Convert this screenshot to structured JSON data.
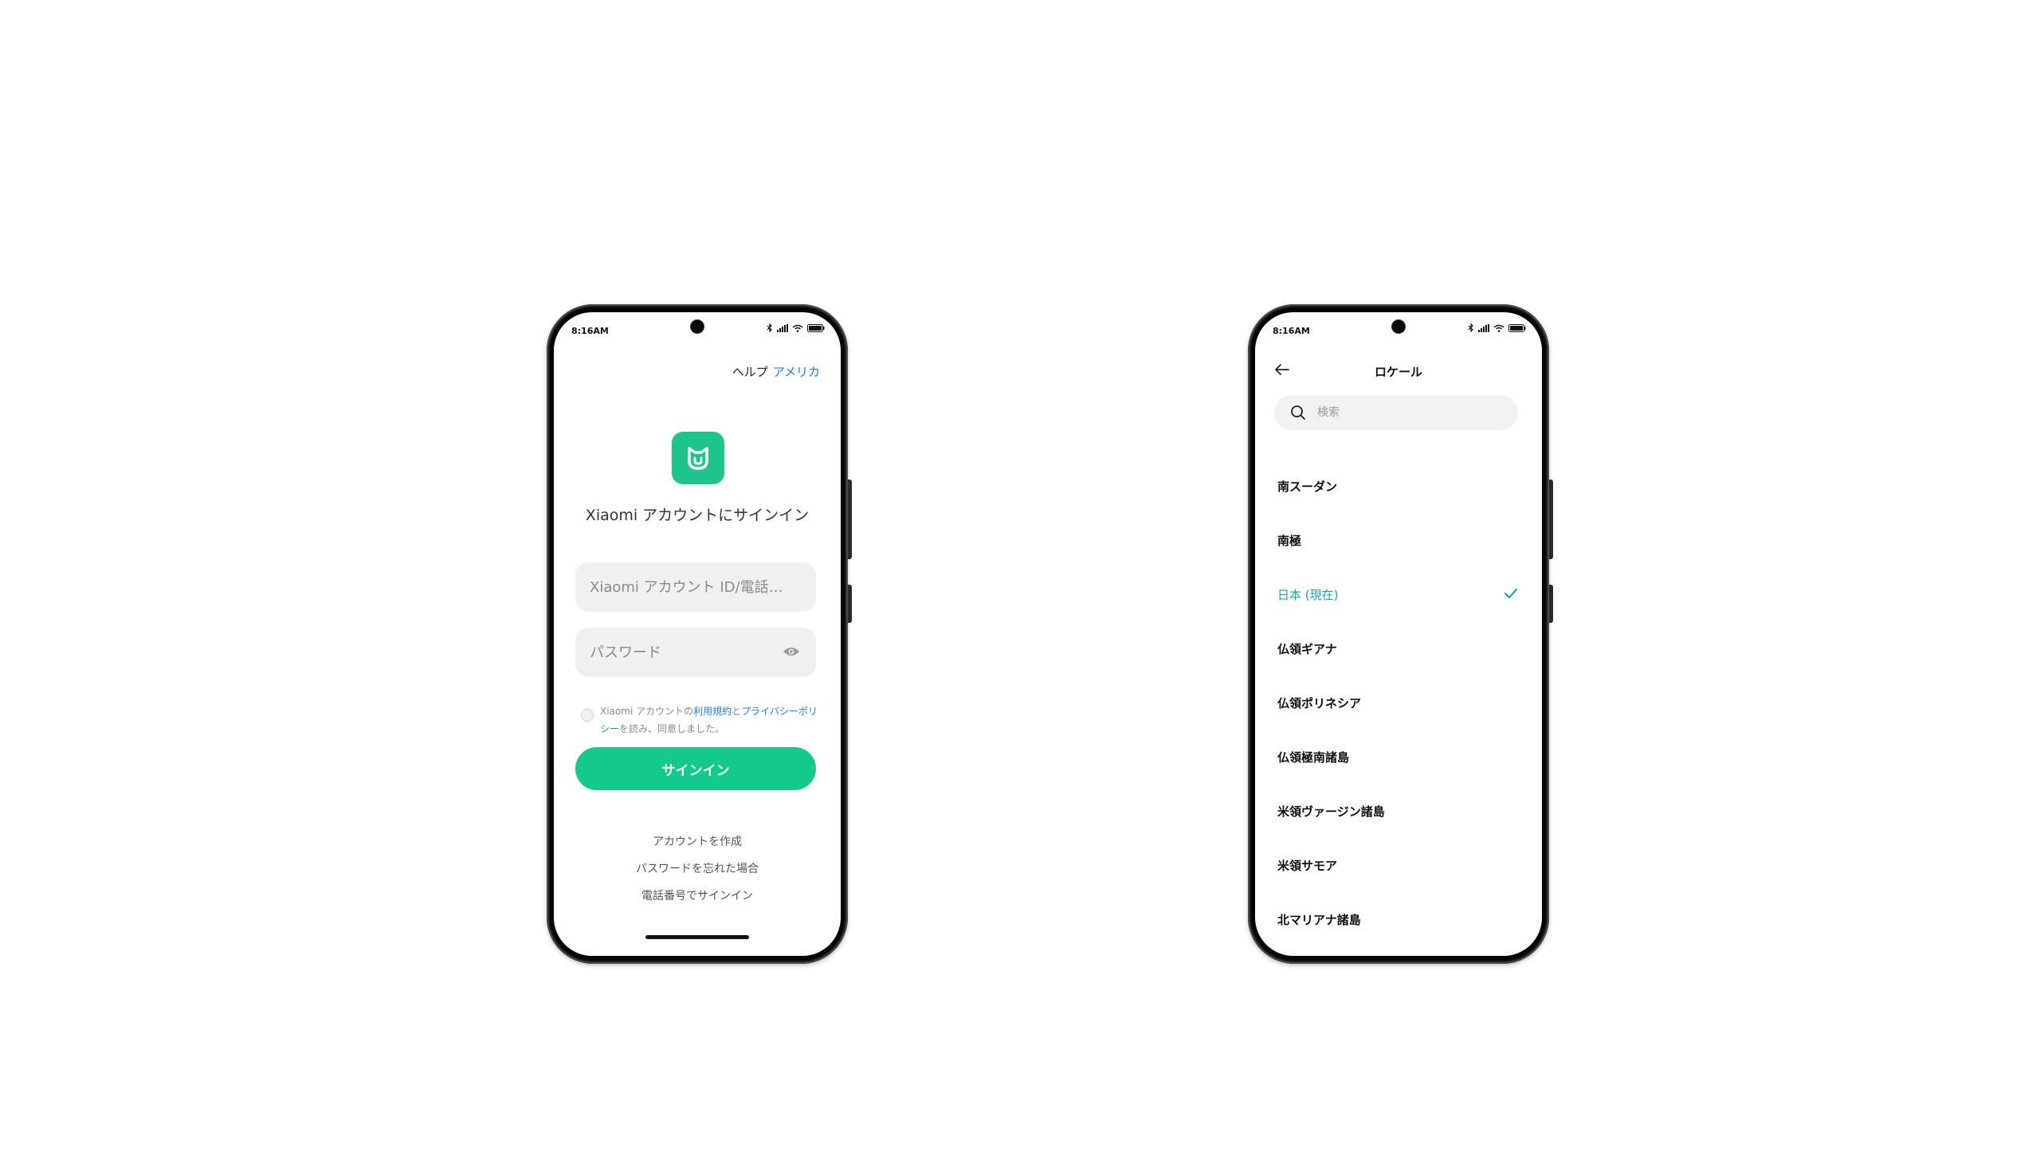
{
  "login_screen": {
    "status_time": "8:16AM",
    "help_label": "ヘルプ",
    "region_label": "アメリカ",
    "title": "Xiaomi アカウントにサインイン",
    "account_placeholder": "Xiaomi アカウント ID/電話…",
    "password_placeholder": "パスワード",
    "agreement": {
      "prefix": "Xiaomi アカウントの",
      "terms_link": "利用規約",
      "and": "と",
      "privacy_link": "プライバシーポリシー",
      "suffix": "を読み、同意しました。"
    },
    "signin_label": "サインイン",
    "create_account": "アカウントを作成",
    "forgot_password": "パスワードを忘れた場合",
    "phone_signin": "電話番号でサインイン",
    "brand_color": "#14c98c",
    "link_color": "#1e7ef0"
  },
  "locale_screen": {
    "status_time": "8:16AM",
    "title": "ロケール",
    "search_placeholder": "検索",
    "selected_color": "#16a8a0",
    "items": [
      {
        "label": "南スーダン",
        "selected": false
      },
      {
        "label": "南極",
        "selected": false
      },
      {
        "label": "日本 (現在)",
        "selected": true
      },
      {
        "label": "仏領ギアナ",
        "selected": false
      },
      {
        "label": "仏領ポリネシア",
        "selected": false
      },
      {
        "label": "仏領極南諸島",
        "selected": false
      },
      {
        "label": "米領ヴァージン諸島",
        "selected": false
      },
      {
        "label": "米領サモア",
        "selected": false
      },
      {
        "label": "北マリアナ諸島",
        "selected": false
      }
    ]
  },
  "icons": [
    "bluetooth-icon",
    "signal-icon",
    "wifi-icon",
    "battery-icon",
    "mi-home-logo-icon",
    "eye-icon",
    "back-arrow-icon",
    "search-icon",
    "check-icon"
  ]
}
